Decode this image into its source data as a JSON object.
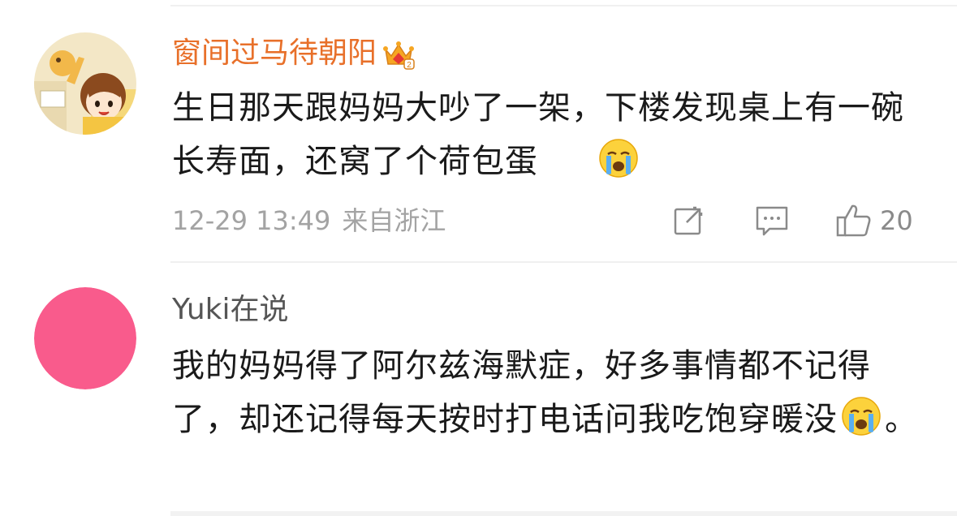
{
  "comments": [
    {
      "author": "窗间过马待朝阳",
      "author_badge": "crown-vip-icon",
      "text_part1": "生日那天跟妈妈大吵了一架，下楼发现桌上有一碗长寿面，还窝了个荷包蛋",
      "emoji": "crying-face-emoji",
      "date": "12-29 13:49",
      "location": "来自浙江",
      "likes": "20",
      "avatar": "anime-girl-avatar"
    },
    {
      "author": "Yuki在说",
      "text_part1": "我的妈妈得了阿尔兹海默症，好多事情都不记得了，却还记得每天按时打电话问我吃饱穿暖没",
      "emoji": "crying-face-emoji",
      "text_part2": "。",
      "avatar": "pink-circle-avatar"
    }
  ],
  "colors": {
    "vip_name": "#e8702a",
    "name": "#555555",
    "body_text": "#1a1a1a",
    "meta_text": "#a3a3a3",
    "icon": "#8a8a8a",
    "avatar_pink": "#f95b8c",
    "divider": "#f0f0f0"
  }
}
